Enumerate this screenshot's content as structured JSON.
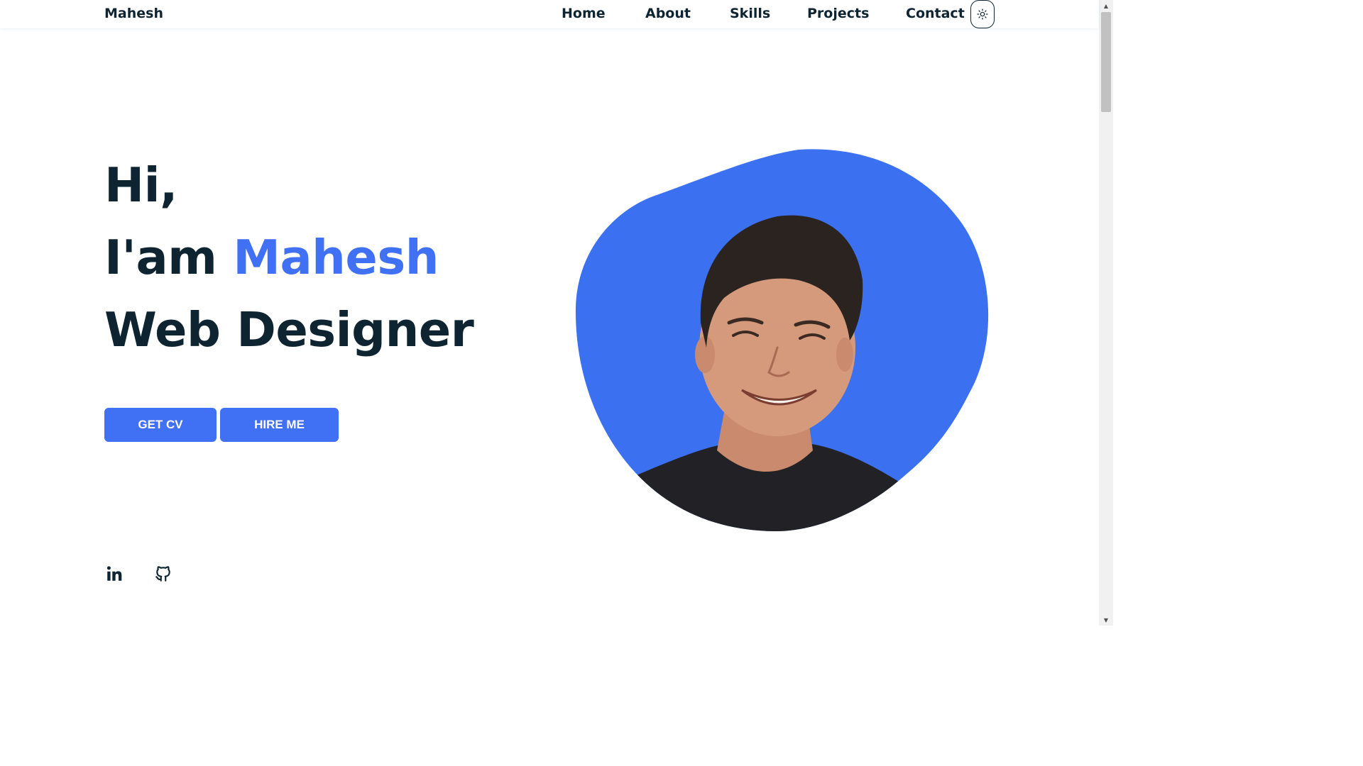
{
  "header": {
    "logo": "Mahesh",
    "nav": [
      "Home",
      "About",
      "Skills",
      "Projects",
      "Contact"
    ],
    "theme_icon": "sun-icon"
  },
  "hero": {
    "line1": "Hi,",
    "line2_prefix": "I'am ",
    "line2_name": "Mahesh",
    "line3": "Web Designer",
    "buttons": {
      "cv": "GET CV",
      "hire": "HIRE ME"
    }
  },
  "social": {
    "linkedin_icon": "linkedin-icon",
    "github_icon": "github-icon"
  },
  "colors": {
    "accent": "#4070f4",
    "text": "#0e2431",
    "blob": "#3b71f0"
  }
}
